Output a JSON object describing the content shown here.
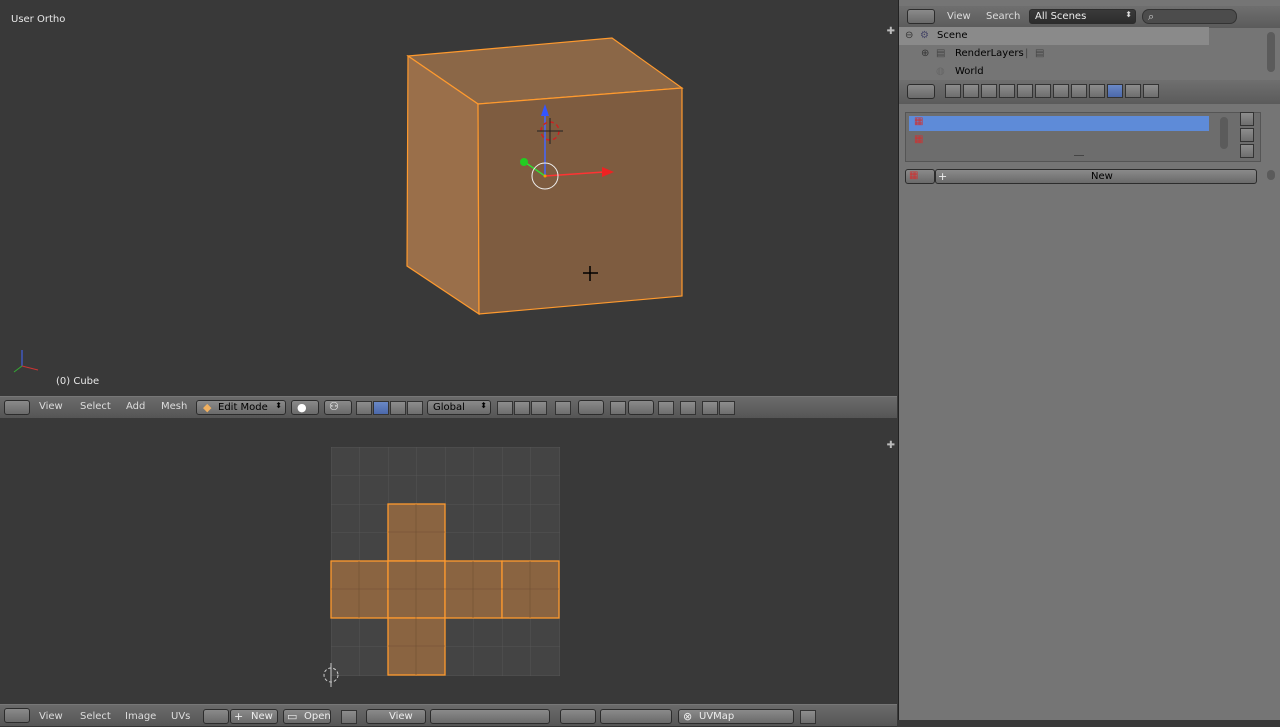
{
  "viewport": {
    "title": "User Ortho",
    "object_label": "(0) Cube"
  },
  "viewport_header": {
    "menus": [
      "View",
      "Select",
      "Add",
      "Mesh"
    ],
    "mode": "Edit Mode",
    "orientation": "Global"
  },
  "uv_header": {
    "menus": [
      "View",
      "Select",
      "Image",
      "UVs"
    ],
    "new_label": "New",
    "open_label": "Open",
    "view_label": "View",
    "uvmap_label": "UVMap"
  },
  "outliner": {
    "view_label": "View",
    "search_label": "Search",
    "scene_select": "All Scenes",
    "search_placeholder": "",
    "items": [
      "Scene",
      "RenderLayers",
      "World"
    ]
  },
  "properties": {
    "new_button": "New"
  },
  "colors": {
    "background": "#393939",
    "panel": "#757575",
    "selection": "#ffa030",
    "face": "#7d5a3c",
    "highlight": "#5e8bd8"
  }
}
